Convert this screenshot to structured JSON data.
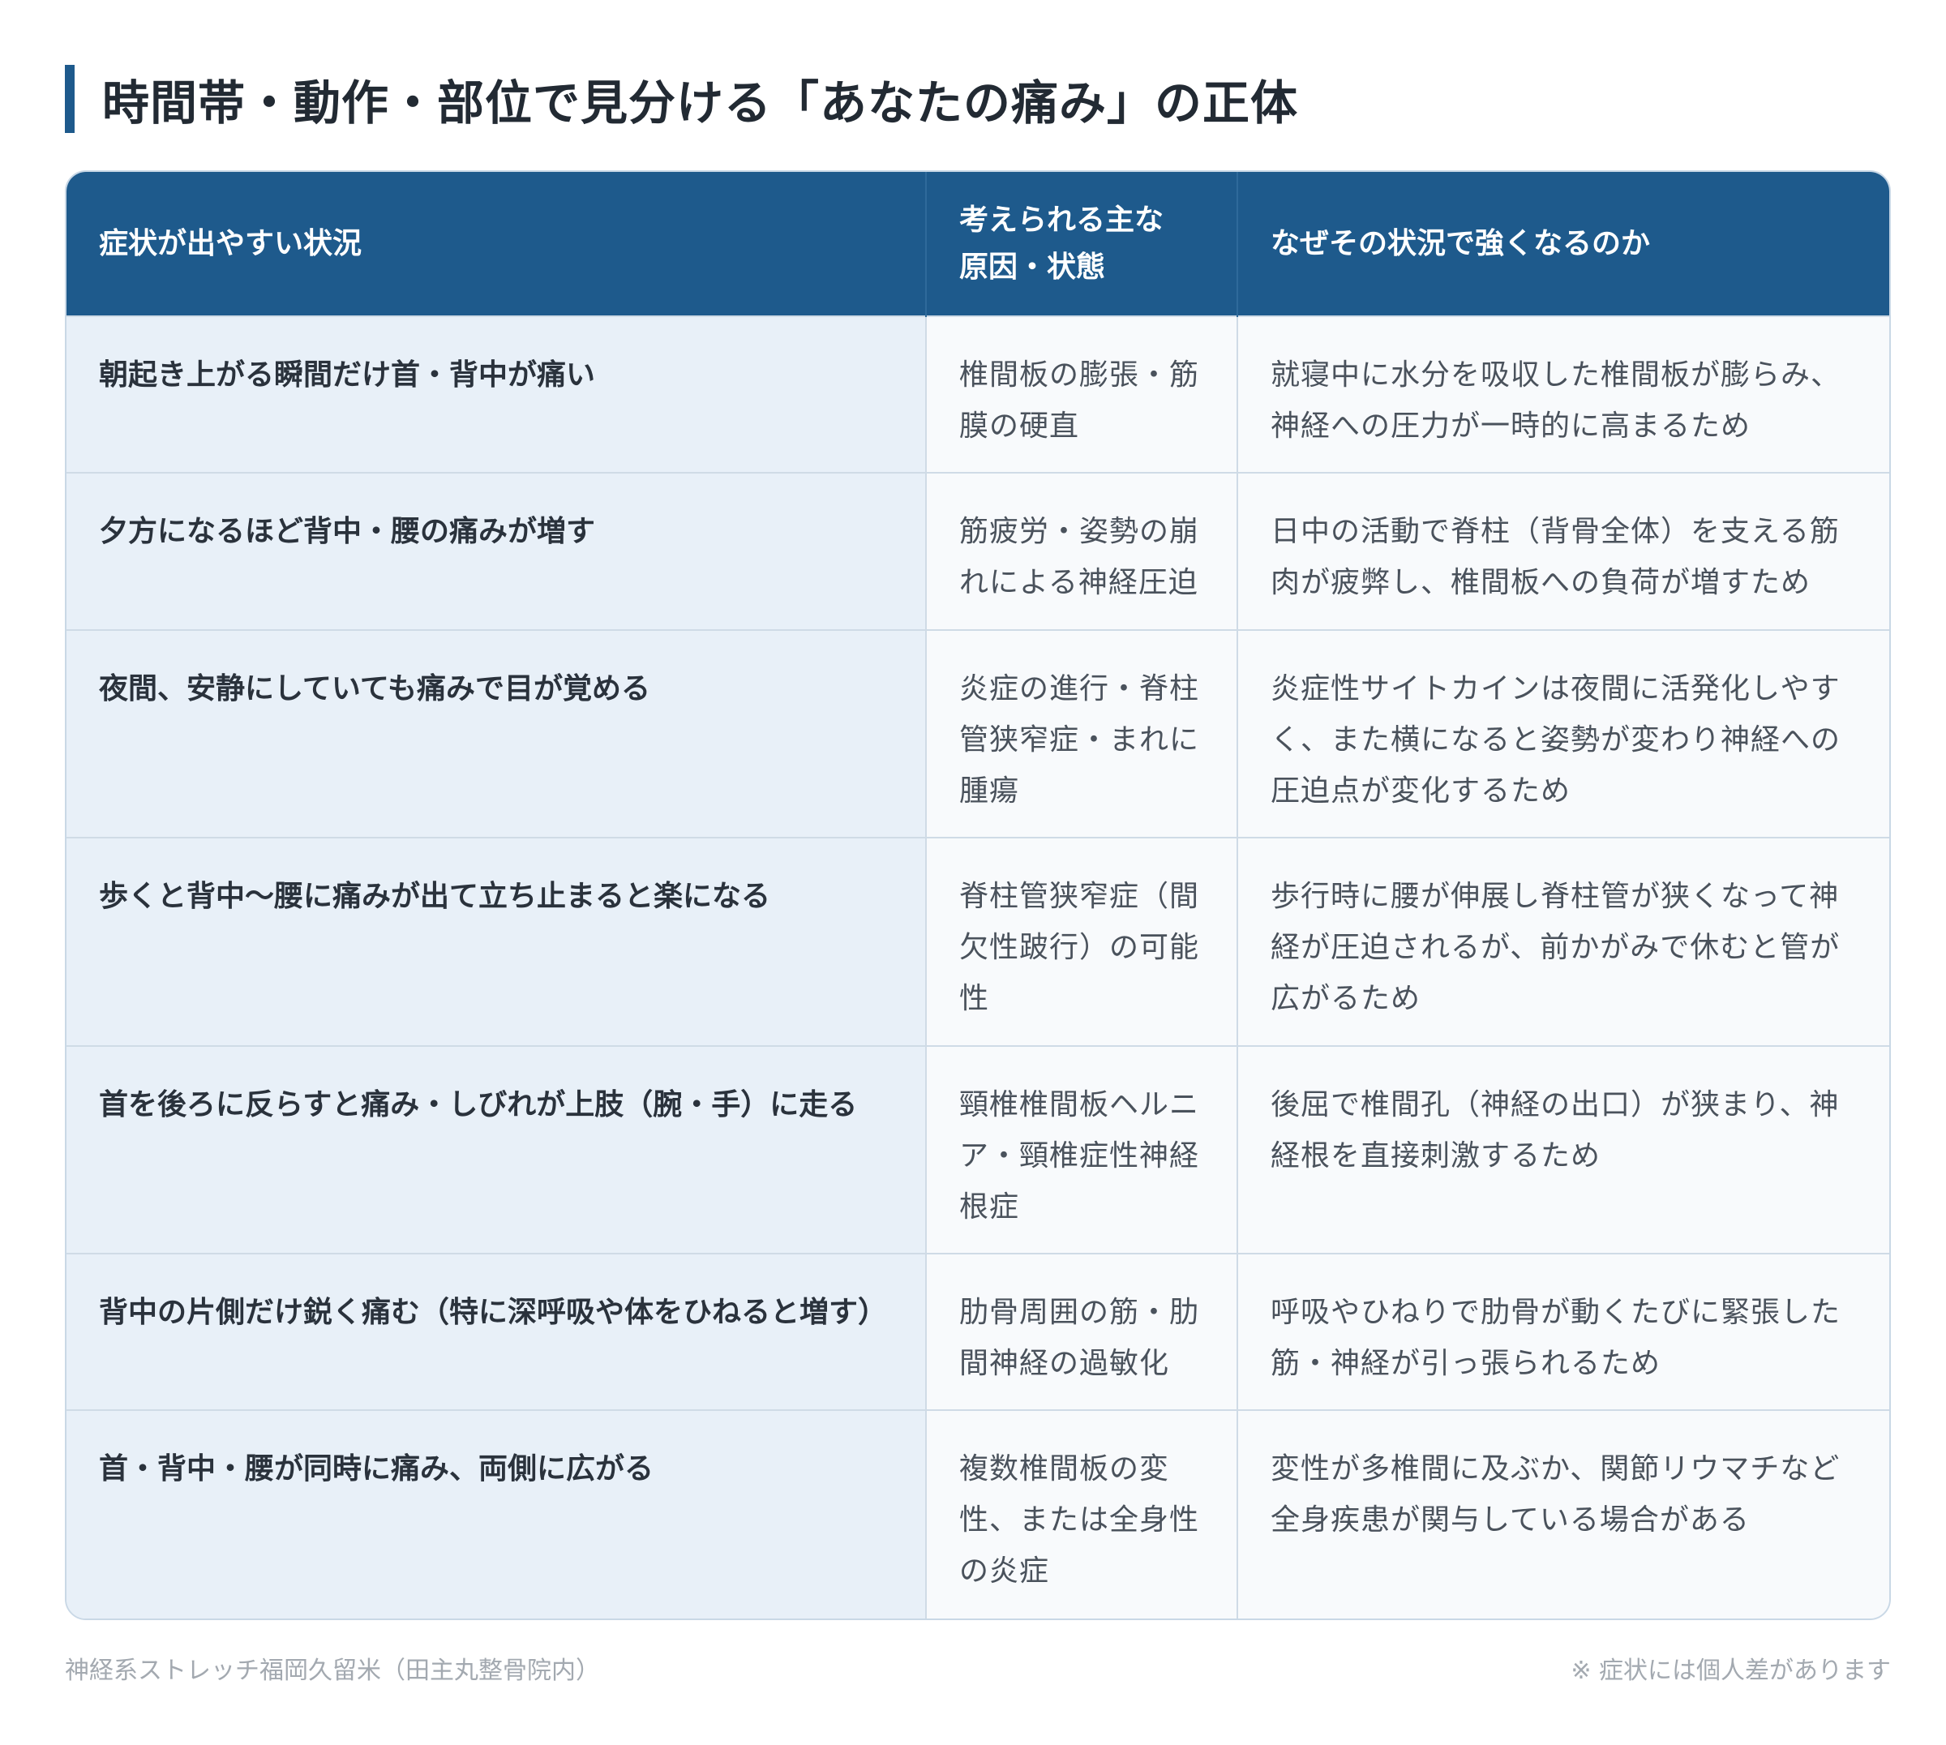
{
  "title": "時間帯・動作・部位で見分ける「あなたの痛み」の正体",
  "table": {
    "headers": {
      "symptom": "症状が出やすい状況",
      "cause_line1": "考えられる主な",
      "cause_line2": "原因・状態",
      "reason": "なぜその状況で強くなるのか"
    },
    "rows": [
      {
        "symptom": "朝起き上がる瞬間だけ首・背中が痛い",
        "cause": "椎間板の膨張・筋膜の硬直",
        "reason": "就寝中に水分を吸収した椎間板が膨らみ、神経への圧力が一時的に高まるため"
      },
      {
        "symptom": "夕方になるほど背中・腰の痛みが増す",
        "cause": "筋疲労・姿勢の崩れによる神経圧迫",
        "reason": "日中の活動で脊柱（背骨全体）を支える筋肉が疲弊し、椎間板への負荷が増すため"
      },
      {
        "symptom": "夜間、安静にしていても痛みで目が覚める",
        "cause": "炎症の進行・脊柱管狭窄症・まれに腫瘍",
        "reason": "炎症性サイトカインは夜間に活発化しやすく、また横になると姿勢が変わり神経への圧迫点が変化するため"
      },
      {
        "symptom": "歩くと背中〜腰に痛みが出て立ち止まると楽になる",
        "cause": "脊柱管狭窄症（間欠性跛行）の可能性",
        "reason": "歩行時に腰が伸展し脊柱管が狭くなって神経が圧迫されるが、前かがみで休むと管が広がるため"
      },
      {
        "symptom": "首を後ろに反らすと痛み・しびれが上肢（腕・手）に走る",
        "cause": "頸椎椎間板ヘルニア・頸椎症性神経根症",
        "reason": "後屈で椎間孔（神経の出口）が狭まり、神経根を直接刺激するため"
      },
      {
        "symptom": "背中の片側だけ鋭く痛む（特に深呼吸や体をひねると増す）",
        "cause": "肋骨周囲の筋・肋間神経の過敏化",
        "reason": "呼吸やひねりで肋骨が動くたびに緊張した筋・神経が引っ張られるため"
      },
      {
        "symptom": "首・背中・腰が同時に痛み、両側に広がる",
        "cause": "複数椎間板の変性、または全身性の炎症",
        "reason": "変性が多椎間に及ぶか、関節リウマチなど全身疾患が関与している場合がある"
      }
    ]
  },
  "footer": {
    "left": "神経系ストレッチ福岡久留米（田主丸整骨院内）",
    "right": "※ 症状には個人差があります"
  }
}
